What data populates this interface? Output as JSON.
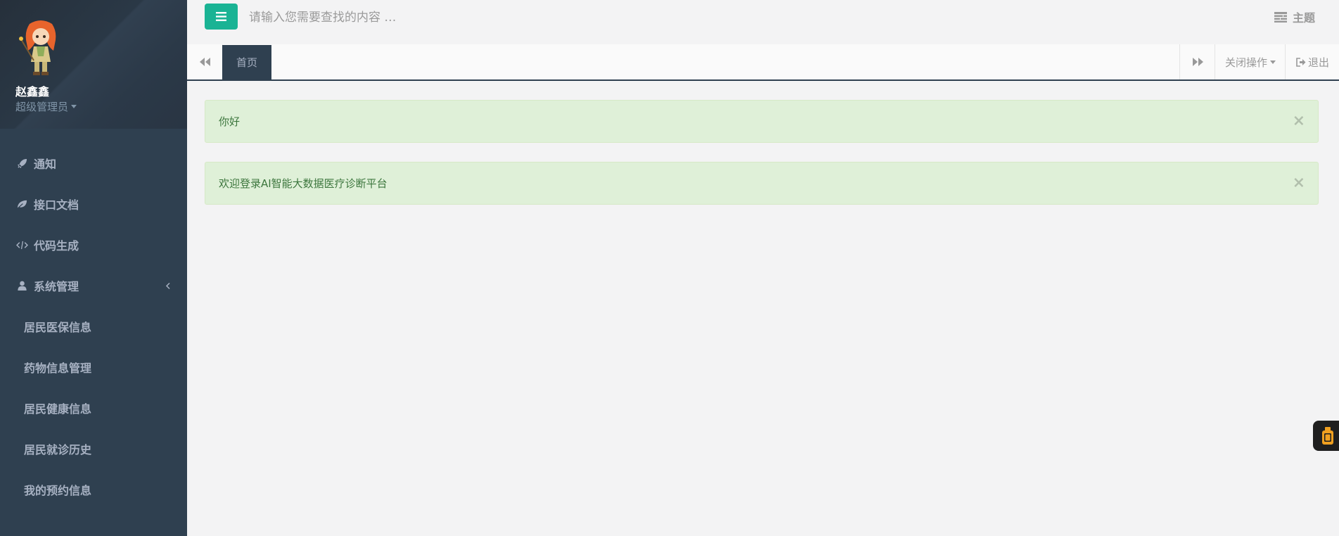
{
  "sidebar": {
    "user_name": "赵鑫鑫",
    "user_role": "超级管理员",
    "items": [
      {
        "label": "通知",
        "icon": "rocket-icon"
      },
      {
        "label": "接口文档",
        "icon": "leaf-icon"
      },
      {
        "label": "代码生成",
        "icon": "code-icon"
      },
      {
        "label": "系统管理",
        "icon": "user-icon"
      }
    ],
    "subitems": [
      {
        "label": "居民医保信息"
      },
      {
        "label": "药物信息管理"
      },
      {
        "label": "居民健康信息"
      },
      {
        "label": "居民就诊历史"
      },
      {
        "label": "我的预约信息"
      }
    ]
  },
  "header": {
    "search_placeholder": "请输入您需要查找的内容 …",
    "theme_label": "主题"
  },
  "tabs": {
    "home_label": "首页",
    "close_ops_label": "关闭操作",
    "exit_label": "退出"
  },
  "alerts": [
    {
      "text": "你好",
      "close": "×"
    },
    {
      "text": "欢迎登录AI智能大数据医疗诊断平台",
      "close": "×"
    }
  ],
  "colors": {
    "sidebar_bg": "#2f4050",
    "accent": "#1ab394",
    "alert_bg": "#dff0d8",
    "alert_text": "#3c763d"
  }
}
